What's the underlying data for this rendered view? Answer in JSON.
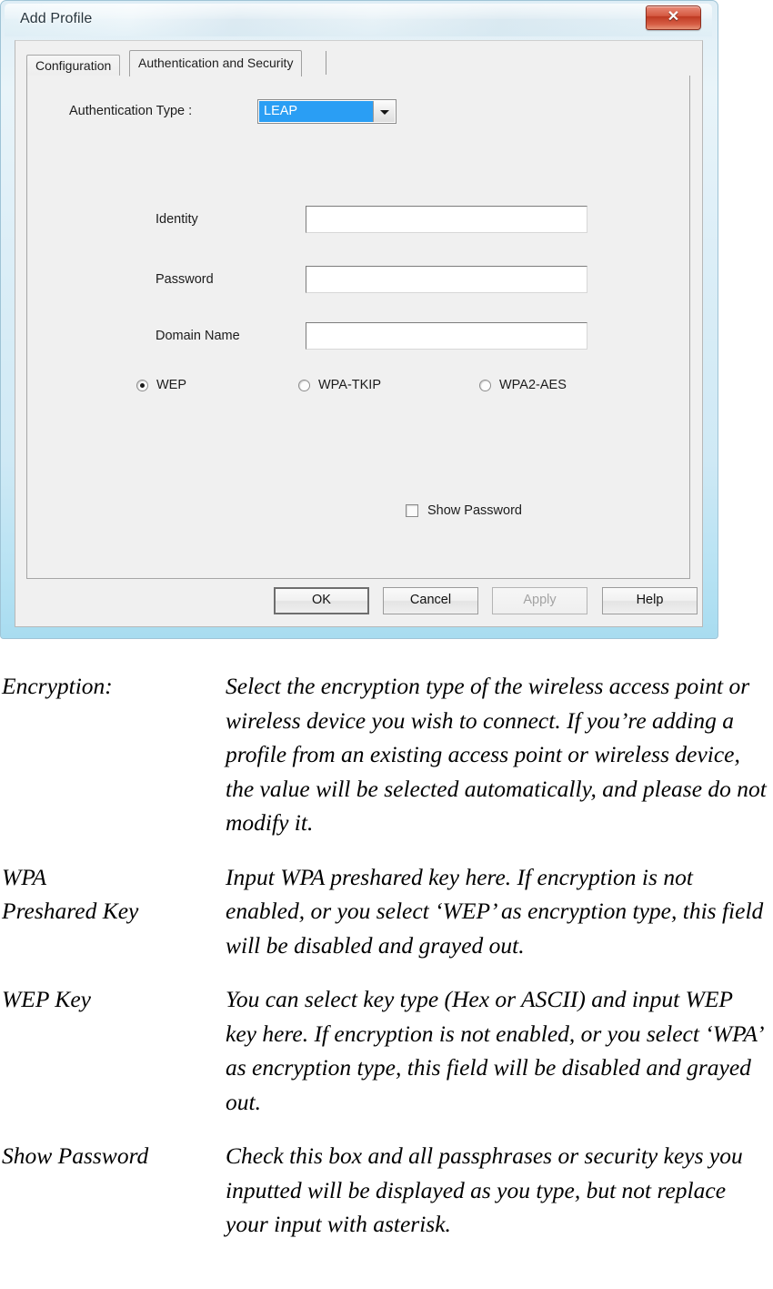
{
  "window": {
    "title": "Add Profile",
    "close_label": "✕"
  },
  "tabs": [
    {
      "label": "Configuration",
      "active": false
    },
    {
      "label": "Authentication and Security",
      "active": true
    }
  ],
  "form": {
    "auth_type_label": "Authentication Type :",
    "auth_type_value": "LEAP",
    "fields": [
      {
        "label": "Identity",
        "value": "",
        "placeholder": ""
      },
      {
        "label": "Password",
        "value": "",
        "placeholder": ""
      },
      {
        "label": "Domain Name",
        "value": "",
        "placeholder": ""
      }
    ],
    "encryption_options": [
      {
        "label": "WEP",
        "selected": true
      },
      {
        "label": "WPA-TKIP",
        "selected": false
      },
      {
        "label": "WPA2-AES",
        "selected": false
      }
    ],
    "show_password": {
      "label": "Show Password",
      "checked": false
    }
  },
  "buttons": [
    {
      "label": "OK",
      "state": "default"
    },
    {
      "label": "Cancel",
      "state": "normal"
    },
    {
      "label": "Apply",
      "state": "disabled"
    },
    {
      "label": "Help",
      "state": "normal"
    }
  ],
  "documentation": [
    {
      "term": "Encryption:",
      "description": "Select the encryption type of the wireless access point or wireless device you wish to connect. If you’re adding a profile from an existing access point or wireless device, the value will be selected automatically, and please do not modify it."
    },
    {
      "term": "WPA\nPreshared Key",
      "description": "Input WPA preshared key here. If encryption is not enabled, or you select ‘WEP’ as encryption type, this field will be disabled and grayed out."
    },
    {
      "term": "WEP Key",
      "description": "You can select key type (Hex or ASCII) and input WEP key here. If encryption is not enabled, or you select ‘WPA’ as encryption type, this field will be disabled and grayed out."
    },
    {
      "term": "Show Password",
      "description": "Check this box and all passphrases or security keys you inputted will be displayed as you type, but not replace your input with asterisk."
    }
  ],
  "colors": {
    "accent_selection": "#2a9ef4",
    "close_button": "#bf3a23",
    "window_glass": "#b6e2f3",
    "dialog_face": "#f0f0f0"
  }
}
